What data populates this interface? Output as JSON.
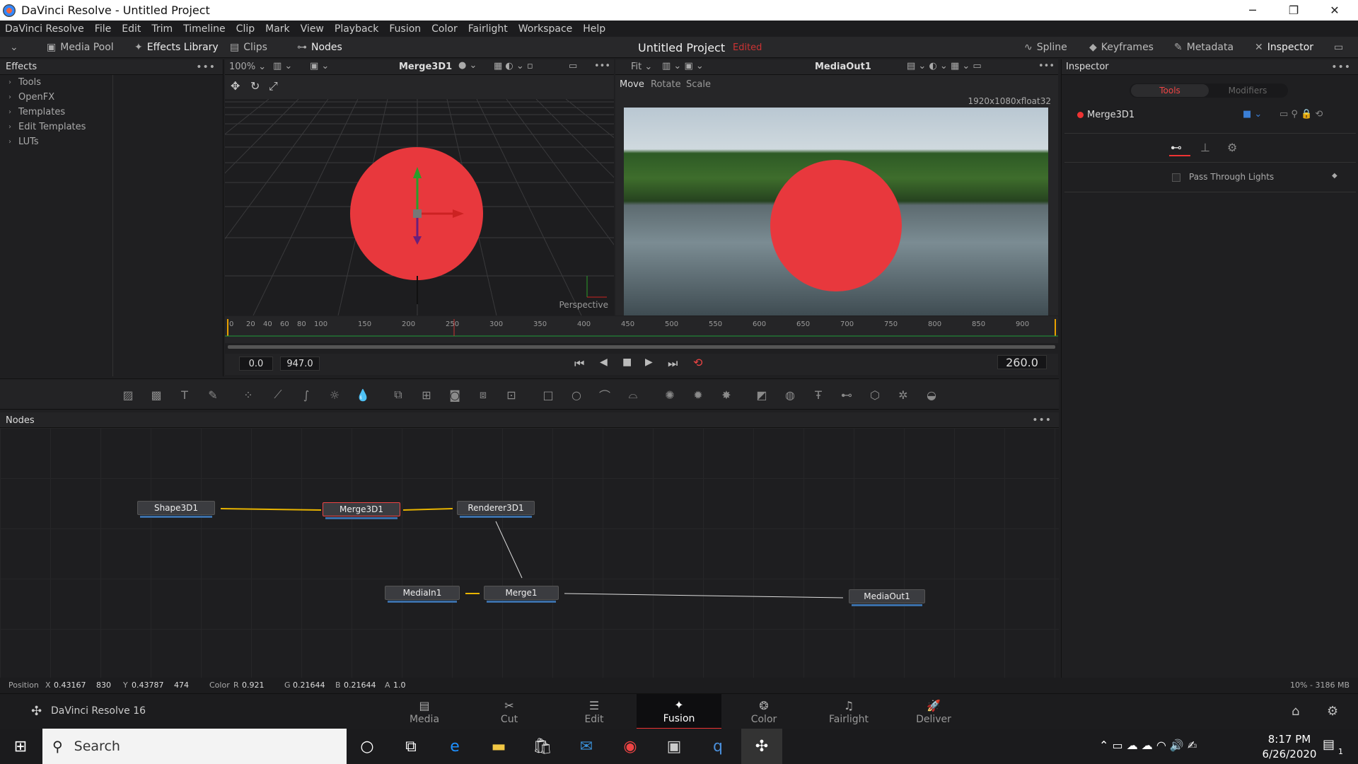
{
  "window": {
    "title": "DaVinci Resolve - Untitled Project"
  },
  "menu": [
    "DaVinci Resolve",
    "File",
    "Edit",
    "Trim",
    "Timeline",
    "Clip",
    "Mark",
    "View",
    "Playback",
    "Fusion",
    "Color",
    "Fairlight",
    "Workspace",
    "Help"
  ],
  "toolbar": {
    "media_pool": "Media Pool",
    "effects_library": "Effects Library",
    "clips": "Clips",
    "nodes": "Nodes",
    "project_title": "Untitled Project",
    "edited": "Edited",
    "spline": "Spline",
    "keyframes": "Keyframes",
    "metadata": "Metadata",
    "inspector": "Inspector"
  },
  "effects": {
    "title": "Effects",
    "items": [
      "Tools",
      "OpenFX",
      "Templates",
      "Edit Templates",
      "LUTs"
    ]
  },
  "viewer_left": {
    "zoom": "100%",
    "node": "Merge3D1",
    "label": "Perspective"
  },
  "viewer_right": {
    "fit": "Fit",
    "node": "MediaOut1",
    "modes": [
      "Move",
      "Rotate",
      "Scale"
    ],
    "resolution": "1920x1080xfloat32"
  },
  "timeline": {
    "ticks": [
      "0",
      "20",
      "40",
      "60",
      "80",
      "100",
      "150",
      "200",
      "250",
      "300",
      "350",
      "400",
      "450",
      "500",
      "550",
      "600",
      "650",
      "700",
      "750",
      "800",
      "850",
      "900"
    ],
    "start": "0.0",
    "end": "947.0",
    "current": "260.0"
  },
  "nodes_panel": {
    "title": "Nodes",
    "nodes": [
      "Shape3D1",
      "Merge3D1",
      "Renderer3D1",
      "MediaIn1",
      "Merge1",
      "MediaOut1"
    ]
  },
  "inspector": {
    "title": "Inspector",
    "tabs": [
      "Tools",
      "Modifiers"
    ],
    "node_name": "Merge3D1",
    "option": "Pass Through Lights"
  },
  "status": {
    "position_label": "Position",
    "x_label": "X",
    "x_value": "0.43167",
    "x_px": "830",
    "y_label": "Y",
    "y_value": "0.43787",
    "y_px": "474",
    "color_label": "Color",
    "r_label": "R",
    "r_value": "0.921",
    "g_label": "G",
    "g_value": "0.21644",
    "b_label": "B",
    "b_value": "0.21644",
    "a_label": "A",
    "a_value": "1.0",
    "memory": "10% - 3186 MB"
  },
  "pages": {
    "brand": "DaVinci Resolve 16",
    "items": [
      "Media",
      "Cut",
      "Edit",
      "Fusion",
      "Color",
      "Fairlight",
      "Deliver"
    ],
    "active": "Fusion"
  },
  "taskbar": {
    "search_placeholder": "Search",
    "time": "8:17 PM",
    "date": "6/26/2020",
    "notifications": "1"
  }
}
